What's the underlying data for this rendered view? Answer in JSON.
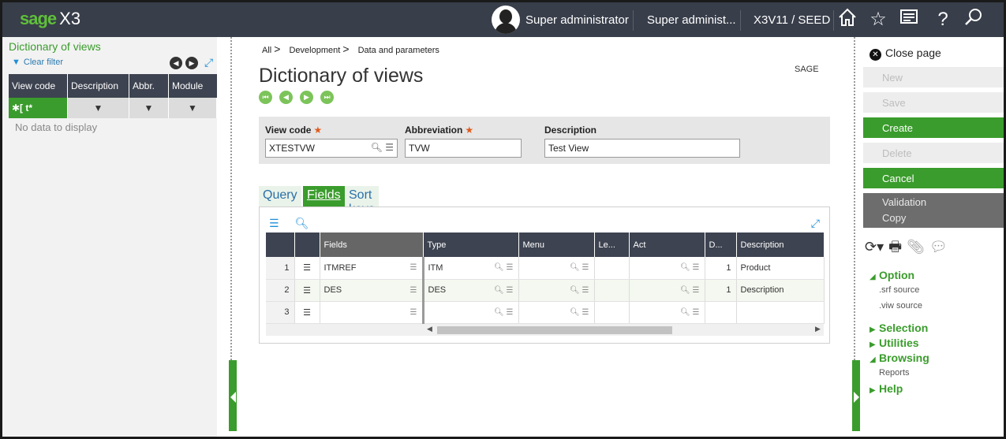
{
  "app": {
    "brand": "sage",
    "product": "X3"
  },
  "topbar": {
    "user": "Super administrator",
    "role": "Super administ...",
    "folder": "X3V11 / SEED"
  },
  "left_panel": {
    "title": "Dictionary of views",
    "clear_filter": "Clear filter",
    "columns": [
      "View code",
      "Description",
      "Abbr.",
      "Module"
    ],
    "filter_first": "t*",
    "empty_text": "No data to display"
  },
  "breadcrumb": [
    "All",
    "Development",
    "Data and parameters"
  ],
  "page": {
    "title": "Dictionary of views",
    "tag": "SAGE"
  },
  "form": {
    "view_code": {
      "label": "View code",
      "value": "XTESTVW",
      "required": true
    },
    "abbreviation": {
      "label": "Abbreviation",
      "value": "TVW",
      "required": true
    },
    "description": {
      "label": "Description",
      "value": "Test View"
    }
  },
  "tabs": [
    "Query",
    "Fields",
    "Sort keys"
  ],
  "active_tab": "Fields",
  "grid": {
    "columns": [
      "Fields",
      "Type",
      "Menu",
      "Le...",
      "Act",
      "D...",
      "Description"
    ],
    "rows": [
      {
        "n": "1",
        "field": "ITMREF",
        "type": "ITM",
        "menu": "",
        "le": "",
        "act": "",
        "d": "1",
        "desc": "Product"
      },
      {
        "n": "2",
        "field": "DES",
        "type": "DES",
        "menu": "",
        "le": "",
        "act": "",
        "d": "1",
        "desc": "Description"
      },
      {
        "n": "3",
        "field": "",
        "type": "",
        "menu": "",
        "le": "",
        "act": "",
        "d": "",
        "desc": ""
      }
    ]
  },
  "right_panel": {
    "close_page": "Close page",
    "actions": [
      "New",
      "Save",
      "Create",
      "Delete",
      "Cancel",
      "Validation",
      "Copy"
    ],
    "sections": {
      "option": "Option",
      "option_items": [
        ".srf source",
        ".viw source"
      ],
      "selection": "Selection",
      "utilities": "Utilities",
      "browsing": "Browsing",
      "browsing_items": [
        "Reports"
      ],
      "help": "Help"
    }
  },
  "colors": {
    "accent": "#3a9c2c",
    "topbar": "#383e4a",
    "grid_header": "#3d4350"
  }
}
